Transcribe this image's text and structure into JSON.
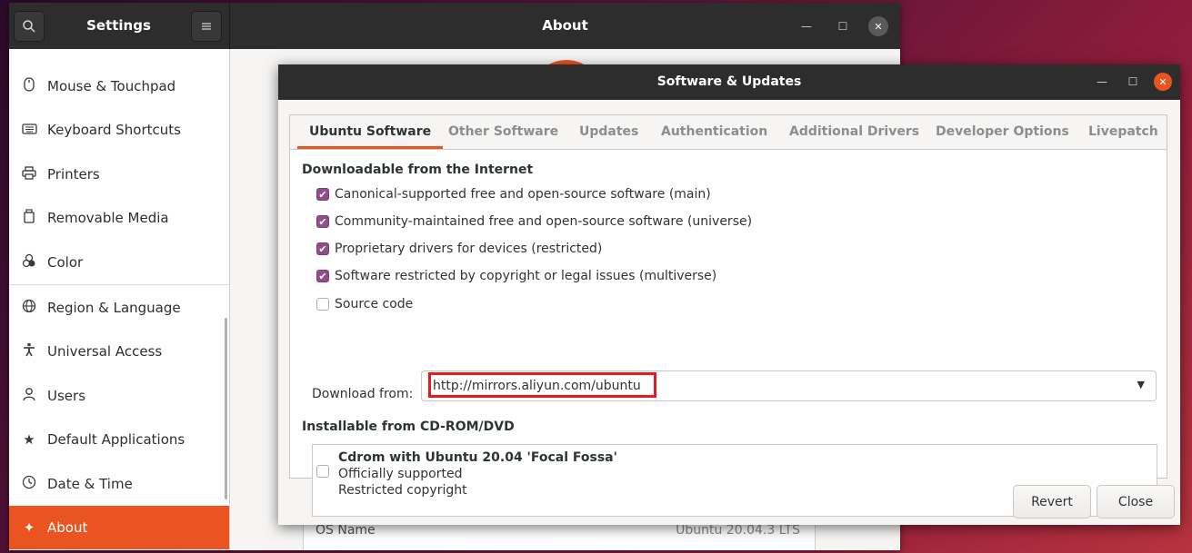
{
  "settings": {
    "title": "Settings",
    "panel_title": "About",
    "sidebar": [
      {
        "label": "Mouse & Touchpad",
        "icon": "mouse-icon"
      },
      {
        "label": "Keyboard Shortcuts",
        "icon": "keyboard-icon"
      },
      {
        "label": "Printers",
        "icon": "printer-icon"
      },
      {
        "label": "Removable Media",
        "icon": "removable-media-icon"
      },
      {
        "label": "Color",
        "icon": "color-icon"
      },
      {
        "label": "Region & Language",
        "icon": "globe-icon"
      },
      {
        "label": "Universal Access",
        "icon": "accessibility-icon"
      },
      {
        "label": "Users",
        "icon": "users-icon"
      },
      {
        "label": "Default Applications",
        "icon": "star-icon"
      },
      {
        "label": "Date & Time",
        "icon": "clock-icon"
      },
      {
        "label": "About",
        "icon": "about-icon",
        "active": true
      }
    ],
    "about_row": {
      "label": "OS Name",
      "value": "Ubuntu 20.04.3 LTS"
    }
  },
  "dialog": {
    "title": "Software & Updates",
    "tabs": [
      {
        "label": "Ubuntu Software",
        "active": true
      },
      {
        "label": "Other Software"
      },
      {
        "label": "Updates"
      },
      {
        "label": "Authentication"
      },
      {
        "label": "Additional Drivers"
      },
      {
        "label": "Developer Options"
      },
      {
        "label": "Livepatch"
      }
    ],
    "downloadable": {
      "heading": "Downloadable from the Internet",
      "options": [
        {
          "label": "Canonical-supported free and open-source software (main)",
          "checked": true
        },
        {
          "label": "Community-maintained free and open-source software (universe)",
          "checked": true
        },
        {
          "label": "Proprietary drivers for devices (restricted)",
          "checked": true
        },
        {
          "label": "Software restricted by copyright or legal issues (multiverse)",
          "checked": true
        },
        {
          "label": "Source code",
          "checked": false
        }
      ],
      "download_from_label": "Download from:",
      "download_from_value": "http://mirrors.aliyun.com/ubuntu"
    },
    "installable": {
      "heading": "Installable from CD-ROM/DVD",
      "cdrom_name": "Cdrom with Ubuntu 20.04 'Focal Fossa'",
      "cdrom_line2": "Officially supported",
      "cdrom_line3": "Restricted copyright",
      "checked": false
    },
    "buttons": {
      "revert": "Revert",
      "close": "Close"
    }
  },
  "colors": {
    "accent": "#e95420",
    "checkbox": "#924d8b",
    "highlight_box": "#e31d1d",
    "titlebar": "#2d2d2d"
  }
}
